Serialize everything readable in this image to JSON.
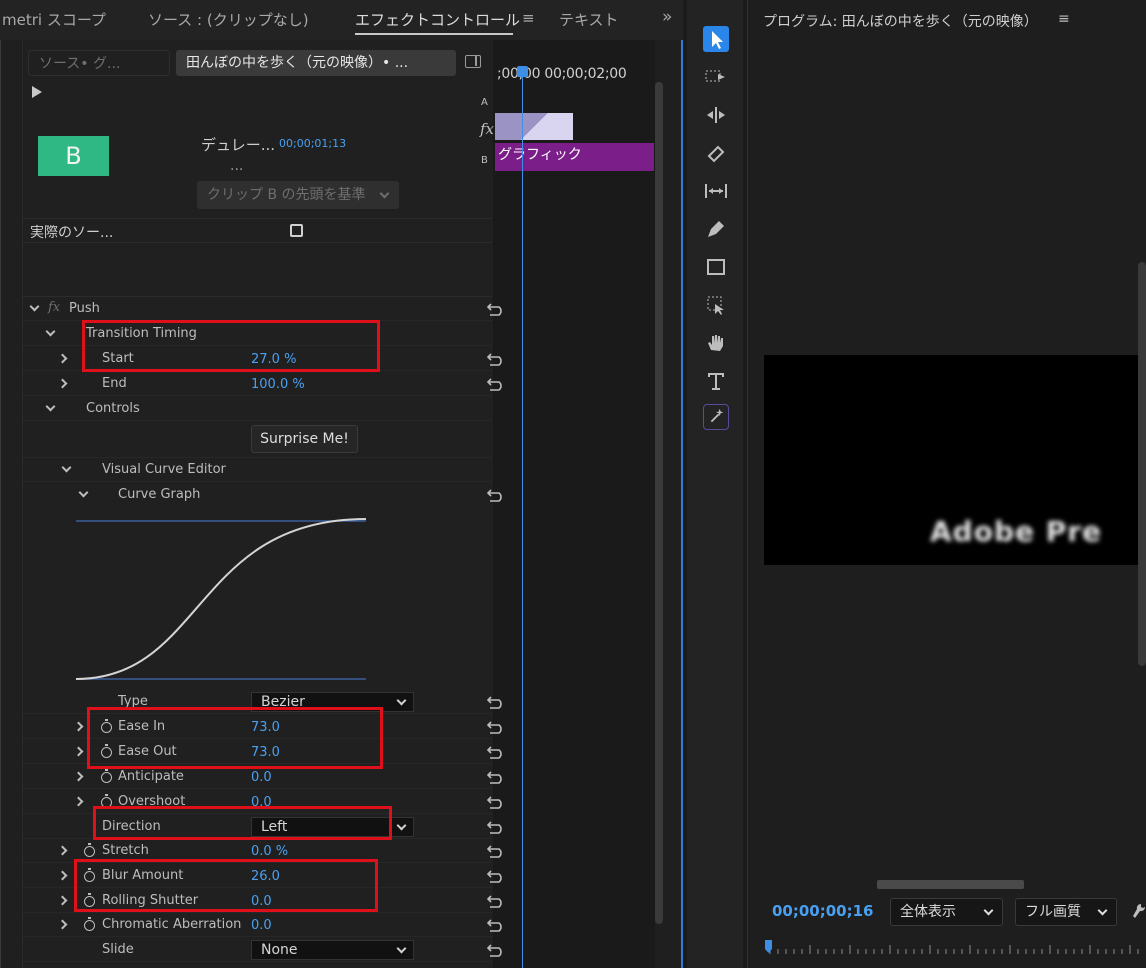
{
  "tabs": {
    "lumetri": "metri スコープ",
    "source": "ソース : (クリップなし)",
    "effect_controls": "エフェクトコントロール",
    "menu": "≡",
    "text": "テキスト",
    "more": "»"
  },
  "source_selector": {
    "inactive": "ソース• グ...",
    "active": "田んぼの中を歩く（元の映像）• ..."
  },
  "timeline": {
    "times": ";00;00 00;00;02;00",
    "track_a": "A",
    "track_b": "B",
    "fx": "fx",
    "clip_label": "グラフィック"
  },
  "transition": {
    "tile_letter": "B",
    "duration_label": "デュレー...",
    "duration_value": "00;00;01;13",
    "ellipsis": "...",
    "alignment": "クリップ B の先頭を基準",
    "actual_source": "実際のソー..."
  },
  "effect": {
    "name": "Push",
    "transition_timing": "Transition Timing",
    "start_label": "Start",
    "start_value": "27.0 %",
    "end_label": "End",
    "end_value": "100.0 %",
    "controls": "Controls",
    "surprise": "Surprise Me!",
    "visual_curve_editor": "Visual Curve Editor",
    "curve_graph": "Curve Graph",
    "type_label": "Type",
    "type_value": "Bezier",
    "ease_in_label": "Ease In",
    "ease_in_value": "73.0",
    "ease_out_label": "Ease Out",
    "ease_out_value": "73.0",
    "anticipate_label": "Anticipate",
    "anticipate_value": "0.0",
    "overshoot_label": "Overshoot",
    "overshoot_value": "0.0",
    "direction_label": "Direction",
    "direction_value": "Left",
    "stretch_label": "Stretch",
    "stretch_value": "0.0 %",
    "blur_label": "Blur Amount",
    "blur_value": "26.0",
    "rolling_label": "Rolling Shutter",
    "rolling_value": "0.0",
    "chroma_label": "Chromatic Aberration",
    "chroma_value": "0.0",
    "slide_label": "Slide",
    "slide_value": "None"
  },
  "program": {
    "title": "プログラム: 田んぼの中を歩く（元の映像）",
    "menu": "≡",
    "video_text": "Adobe Pre",
    "timecode": "00;00;00;16",
    "fit": "全体表示",
    "quality": "フル画質"
  },
  "colors": {
    "accent_blue": "#4aa0f0",
    "highlight_red": "#e0101a",
    "clip_purple": "#7b1e8a",
    "tile_green": "#2fb883"
  }
}
